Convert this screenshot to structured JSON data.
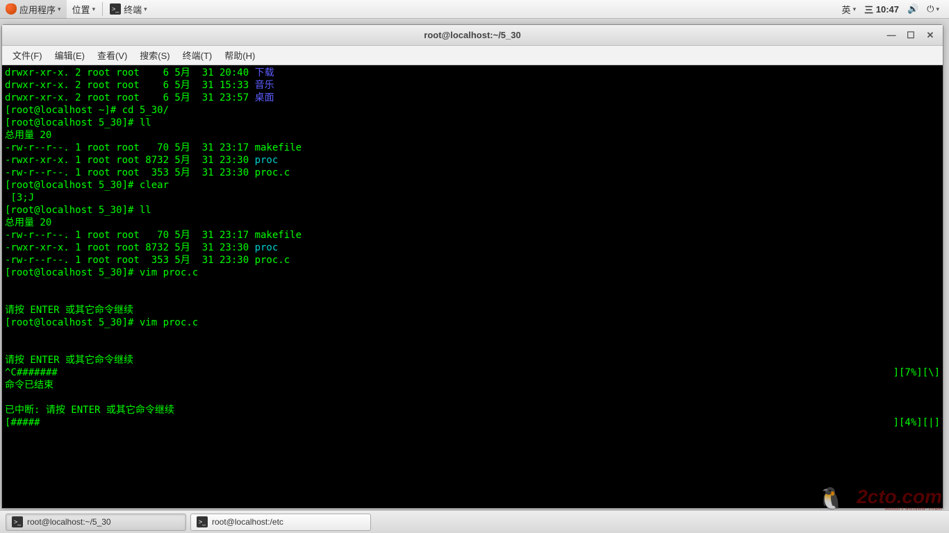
{
  "panel": {
    "apps_label": "应用程序",
    "places_label": "位置",
    "terminal_label": "终端",
    "ime": "英",
    "date": "三",
    "time": "10:47"
  },
  "window": {
    "title": "root@localhost:~/5_30",
    "menu": {
      "file": "文件(F)",
      "edit": "编辑(E)",
      "view": "查看(V)",
      "search": "搜索(S)",
      "terminal": "终端(T)",
      "help": "帮助(H)"
    }
  },
  "terminal": {
    "lines": [
      {
        "parts": [
          {
            "cls": "t-green",
            "txt": "drwxr-xr-x. 2 root root    6 5月  31 20:40 "
          },
          {
            "cls": "t-blue",
            "txt": "下载"
          }
        ]
      },
      {
        "parts": [
          {
            "cls": "t-green",
            "txt": "drwxr-xr-x. 2 root root    6 5月  31 15:33 "
          },
          {
            "cls": "t-blue",
            "txt": "音乐"
          }
        ]
      },
      {
        "parts": [
          {
            "cls": "t-green",
            "txt": "drwxr-xr-x. 2 root root    6 5月  31 23:57 "
          },
          {
            "cls": "t-blue",
            "txt": "桌面"
          }
        ]
      },
      {
        "parts": [
          {
            "cls": "t-green",
            "txt": "[root@localhost ~]# cd 5_30/"
          }
        ]
      },
      {
        "parts": [
          {
            "cls": "t-green",
            "txt": "[root@localhost 5_30]# ll"
          }
        ]
      },
      {
        "parts": [
          {
            "cls": "t-green",
            "txt": "总用量 20"
          }
        ]
      },
      {
        "parts": [
          {
            "cls": "t-green",
            "txt": "-rw-r--r--. 1 root root   70 5月  31 23:17 makefile"
          }
        ]
      },
      {
        "parts": [
          {
            "cls": "t-green",
            "txt": "-rwxr-xr-x. 1 root root 8732 5月  31 23:30 "
          },
          {
            "cls": "t-cyan",
            "txt": "proc"
          }
        ]
      },
      {
        "parts": [
          {
            "cls": "t-green",
            "txt": "-rw-r--r--. 1 root root  353 5月  31 23:30 proc.c"
          }
        ]
      },
      {
        "parts": [
          {
            "cls": "t-green",
            "txt": "[root@localhost 5_30]# clear"
          }
        ]
      },
      {
        "parts": [
          {
            "cls": "t-green",
            "txt": " [3;J"
          }
        ]
      },
      {
        "parts": [
          {
            "cls": "t-green",
            "txt": "[root@localhost 5_30]# ll"
          }
        ]
      },
      {
        "parts": [
          {
            "cls": "t-green",
            "txt": "总用量 20"
          }
        ]
      },
      {
        "parts": [
          {
            "cls": "t-green",
            "txt": "-rw-r--r--. 1 root root   70 5月  31 23:17 makefile"
          }
        ]
      },
      {
        "parts": [
          {
            "cls": "t-green",
            "txt": "-rwxr-xr-x. 1 root root 8732 5月  31 23:30 "
          },
          {
            "cls": "t-cyan",
            "txt": "proc"
          }
        ]
      },
      {
        "parts": [
          {
            "cls": "t-green",
            "txt": "-rw-r--r--. 1 root root  353 5月  31 23:30 proc.c"
          }
        ]
      },
      {
        "parts": [
          {
            "cls": "t-green",
            "txt": "[root@localhost 5_30]# vim proc.c"
          }
        ]
      },
      {
        "parts": [
          {
            "cls": "t-green",
            "txt": " "
          }
        ]
      },
      {
        "parts": [
          {
            "cls": "t-green",
            "txt": " "
          }
        ]
      },
      {
        "parts": [
          {
            "cls": "t-green",
            "txt": "请按 ENTER 或其它命令继续"
          }
        ]
      },
      {
        "parts": [
          {
            "cls": "t-green",
            "txt": "[root@localhost 5_30]# vim proc.c"
          }
        ]
      },
      {
        "parts": [
          {
            "cls": "t-green",
            "txt": " "
          }
        ]
      },
      {
        "parts": [
          {
            "cls": "t-green",
            "txt": " "
          }
        ]
      },
      {
        "parts": [
          {
            "cls": "t-green",
            "txt": "请按 ENTER 或其它命令继续"
          }
        ]
      },
      {
        "parts": [
          {
            "cls": "t-green",
            "txt": "^C#######"
          }
        ],
        "right": "][7%][\\]"
      },
      {
        "parts": [
          {
            "cls": "t-green",
            "txt": "命令已结束"
          }
        ]
      },
      {
        "parts": [
          {
            "cls": "t-green",
            "txt": " "
          }
        ]
      },
      {
        "parts": [
          {
            "cls": "t-green",
            "txt": "已中断: 请按 ENTER 或其它命令继续"
          }
        ]
      },
      {
        "parts": [
          {
            "cls": "t-green",
            "txt": "[#####"
          }
        ],
        "right": "][4%][|]"
      }
    ]
  },
  "taskbar": {
    "items": [
      {
        "label": "root@localhost:~/5_30",
        "active": true
      },
      {
        "label": "root@localhost:/etc",
        "active": false
      }
    ]
  },
  "watermark": {
    "main": "2cto.com",
    "sub": "www.Linuxidc.com"
  }
}
